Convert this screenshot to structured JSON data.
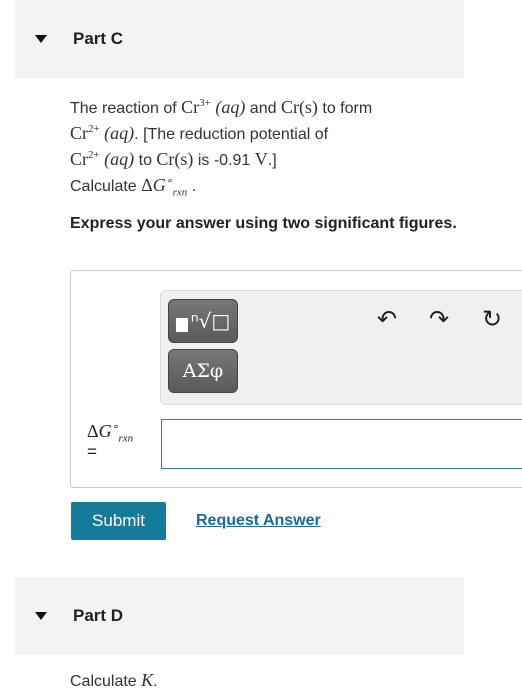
{
  "partC": {
    "title": "Part C",
    "question": {
      "text1": "The reaction of ",
      "species1": "Cr",
      "species1_charge": "3+",
      "aq1": "(aq)",
      "and": " and ",
      "species2": "Cr(s)",
      "text2": " to form",
      "species3": "Cr",
      "species3_charge": "2+",
      "aq3": "(aq)",
      "text3": ". [The reduction potential of",
      "species4": "Cr",
      "species4_charge": "2+",
      "aq4": "(aq)",
      "text4": " to ",
      "species5": "Cr(s)",
      "text5": " is -0.91 ",
      "unit": "V",
      "text6": ".]",
      "calc": "Calculate ",
      "delta": "Δ",
      "g": "G",
      "sup": "∘",
      "sub": "rxn",
      "period": " ."
    },
    "instructions": "Express your answer using two significant figures.",
    "answer": {
      "label_delta": "Δ",
      "label_g": "G",
      "label_sup": "∘",
      "label_sub": "rxn",
      "label_eq": "=",
      "value": ""
    },
    "toolbar": {
      "templates_icon": "templates-icon",
      "templates_glyph": "ⁿ√□",
      "symbols_label": "ΑΣφ",
      "undo_icon": "undo-icon",
      "redo_icon": "redo-icon",
      "reset_icon": "reset-icon"
    },
    "submit_label": "Submit",
    "request_label": "Request Answer"
  },
  "partD": {
    "title": "Part D",
    "question_text": "Calculate ",
    "question_var": "K",
    "question_end": "."
  },
  "colors": {
    "header_bg": "#f3f3f3",
    "submit_bg": "#147b9b",
    "link": "#1a6b93",
    "input_border": "#2e7fa8"
  }
}
